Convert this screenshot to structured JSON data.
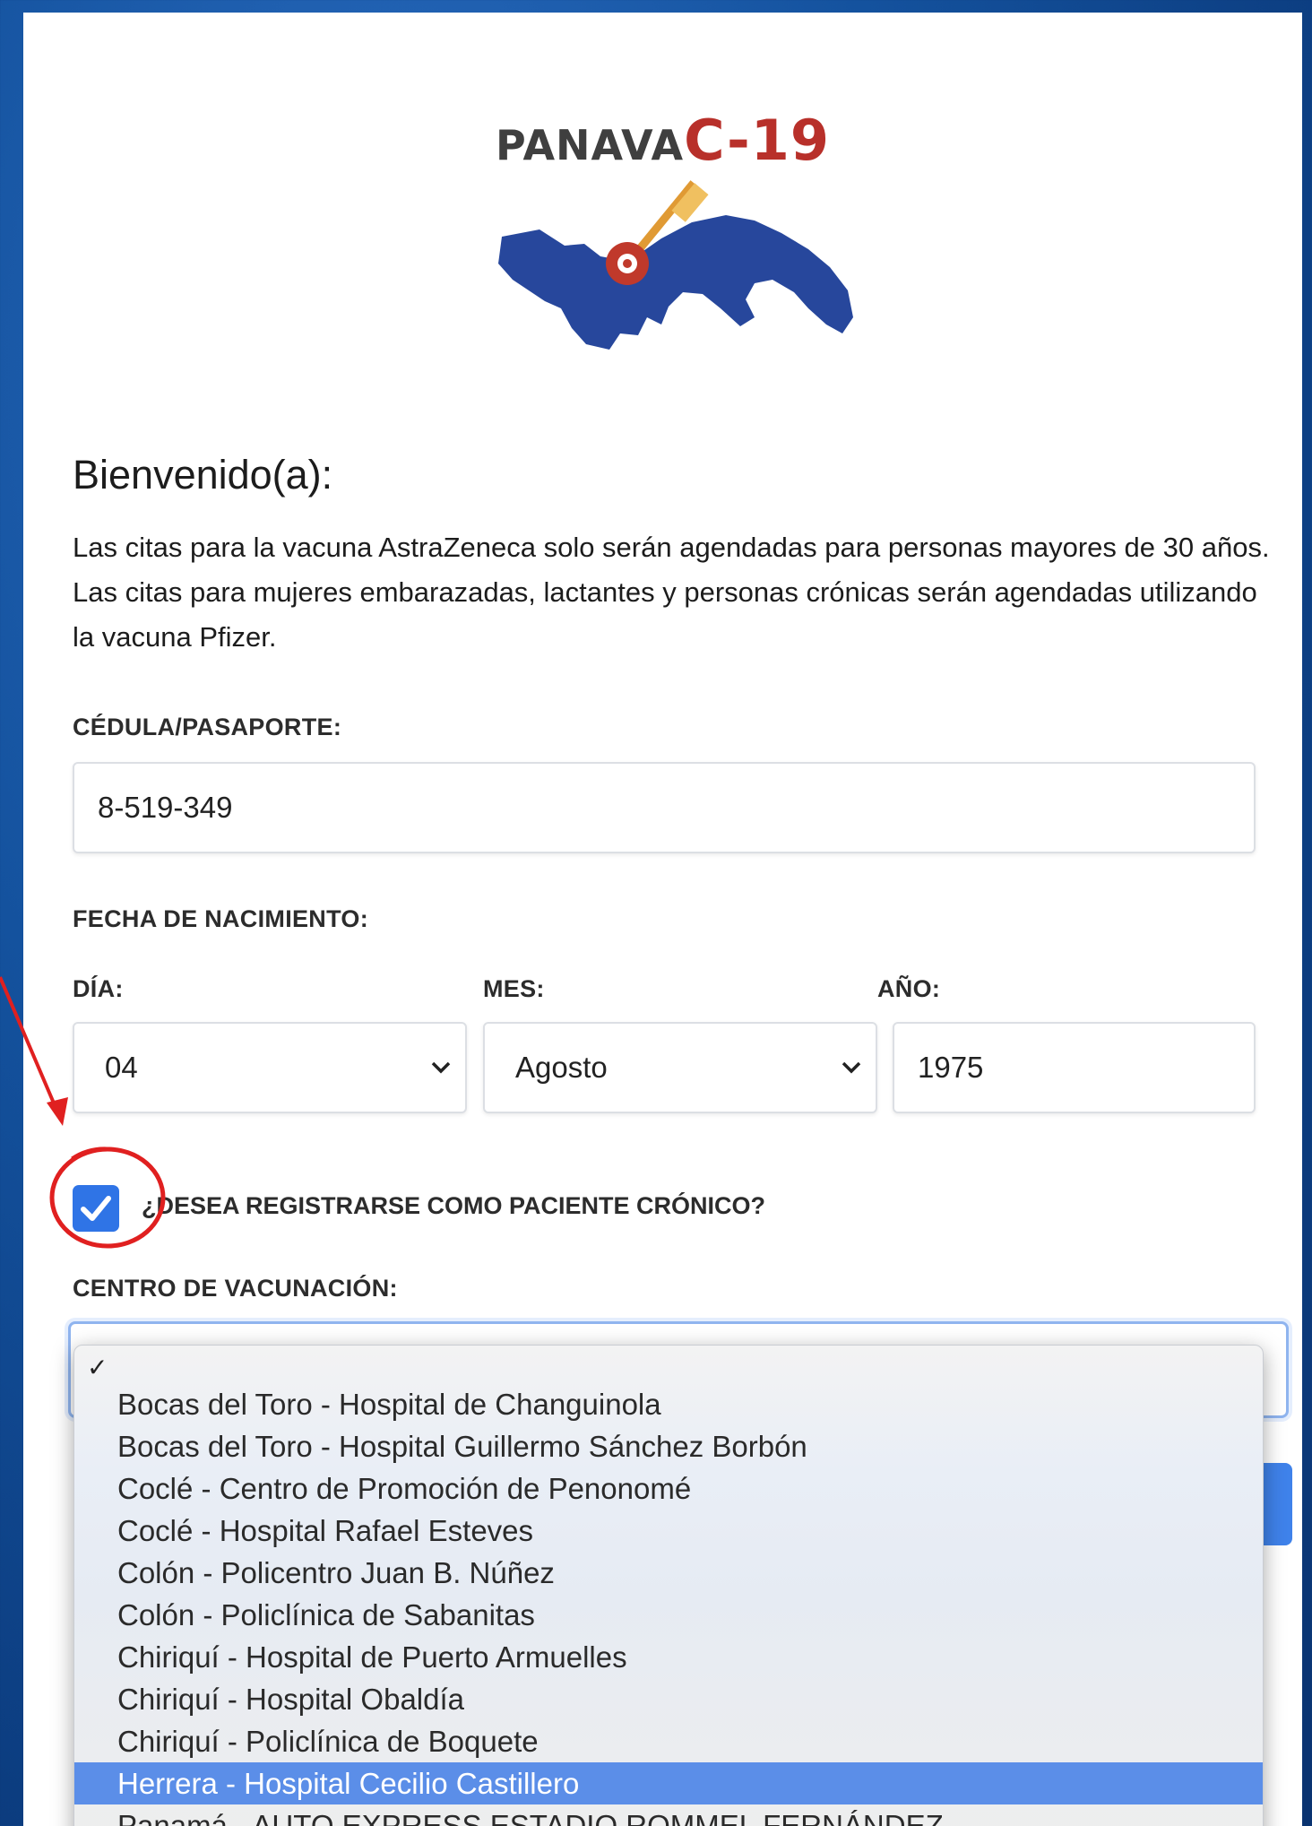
{
  "logo": {
    "title_part1": "PANAVA",
    "title_part2": "C-19"
  },
  "welcome": {
    "heading": "Bienvenido(a):",
    "text": "Las citas para la vacuna AstraZeneca solo serán agendadas para personas mayores de 30 años. Las citas para mujeres embarazadas, lactantes y personas crónicas serán agendadas utilizando la vacuna Pfizer."
  },
  "id_field": {
    "label": "CÉDULA/PASAPORTE:",
    "value": "8-519-349"
  },
  "dob": {
    "label": "FECHA DE NACIMIENTO:",
    "day_label": "DÍA:",
    "day_value": "04",
    "month_label": "MES:",
    "month_value": "Agosto",
    "year_label": "AÑO:",
    "year_value": "1975"
  },
  "chronic": {
    "label": "¿DESEA REGISTRARSE COMO PACIENTE CRÓNICO?",
    "checked": true
  },
  "center": {
    "label": "CENTRO DE VACUNACIÓN:",
    "options": [
      "Bocas del Toro - Hospital de Changuinola",
      "Bocas del Toro - Hospital Guillermo Sánchez Borbón",
      "Coclé - Centro de Promoción de Penonomé",
      "Coclé - Hospital Rafael Esteves",
      "Colón - Policentro Juan B. Núñez",
      "Colón - Policlínica de Sabanitas",
      "Chiriquí - Hospital de Puerto Armuelles",
      "Chiriquí - Hospital Obaldía",
      "Chiriquí - Policlínica de Boquete",
      "Herrera - Hospital Cecilio Castillero",
      "Panamá - AUTO EXPRESS ESTADIO ROMMEL FERNÁNDEZ"
    ],
    "highlighted": "Herrera - Hospital Cecilio Castillero"
  },
  "colors": {
    "accent": "#2f74e6",
    "brand_red": "#b8302a",
    "map_blue": "#27479c",
    "annotation_red": "#e02020"
  }
}
